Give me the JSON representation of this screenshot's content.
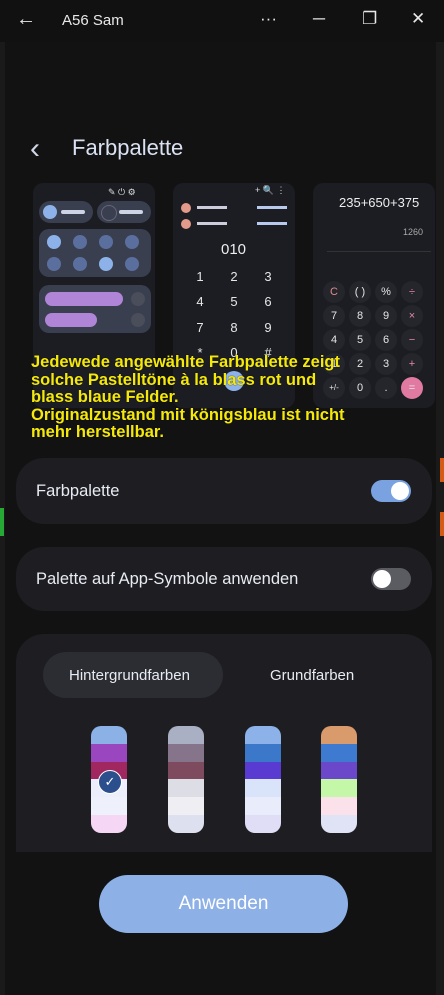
{
  "window": {
    "title": "A56 Sam",
    "back_glyph": "←",
    "more_glyph": "···",
    "minimize_glyph": "─",
    "restore_glyph": "❐",
    "close_glyph": "✕"
  },
  "header": {
    "back_glyph": "‹",
    "title": "Farbpalette"
  },
  "preview": {
    "dialer_display": "010",
    "dialer_keys": [
      "1",
      "2",
      "3",
      "4",
      "5",
      "6",
      "7",
      "8",
      "9",
      "*",
      "0",
      "#"
    ],
    "calc_expression": "235+650+375",
    "calc_result": "1260",
    "calc_keys": [
      "C",
      "( )",
      "%",
      "÷",
      "7",
      "8",
      "9",
      "×",
      "4",
      "5",
      "6",
      "−",
      "1",
      "2",
      "3",
      "+",
      "+/-",
      "0",
      ".",
      "="
    ]
  },
  "note": {
    "line1": "Jedewede angewählte Farbpalette zeigt",
    "line2": "solche Pastelltöne à la blass rot und",
    "line3": "blass blaue Felder.",
    "line4": "Originalzustand mit königsblau ist nicht",
    "line5": "mehr herstellbar."
  },
  "settings": {
    "color_palette_label": "Farbpalette",
    "color_palette_on": true,
    "app_icons_label": "Palette auf App-Symbole anwenden",
    "app_icons_on": false
  },
  "palette_panel": {
    "tabs": [
      "Hintergrundfarben",
      "Grundfarben"
    ],
    "selected_tab": 0,
    "selected_swatch": 0,
    "swatches": [
      [
        "#8bb1e6",
        "#9a47bf",
        "#a0275f",
        "#eceefb",
        "#eef0fb",
        "#f5d6f4"
      ],
      [
        "#aab0c3",
        "#85748a",
        "#7e4a5e",
        "#dddde5",
        "#eeeef3",
        "#dde1ef"
      ],
      [
        "#8db2ea",
        "#3c78c9",
        "#5a3bd1",
        "#d9e4fb",
        "#e8ecfb",
        "#e0ddf6"
      ],
      [
        "#d99a6c",
        "#3d7ad0",
        "#6b48c9",
        "#c4f7a8",
        "#fbe2ea",
        "#e0e3f5"
      ]
    ]
  },
  "apply_label": "Anwenden",
  "colors": {
    "accent": "#8db0e6",
    "note_text": "#f5e90b",
    "toggle_on": "#7ba2e0"
  }
}
